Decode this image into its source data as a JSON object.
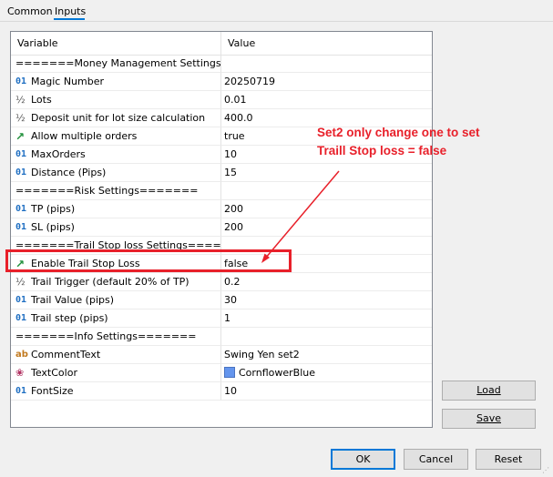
{
  "tabs": {
    "common": "Common",
    "inputs": "Inputs"
  },
  "grid": {
    "col_variable": "Variable",
    "col_value": "Value",
    "rows": [
      {
        "icon": "",
        "variable": "=======Money Management Settings==...",
        "value": ""
      },
      {
        "icon": "01",
        "variable": "Magic Number",
        "value": "20250719"
      },
      {
        "icon": "½",
        "variable": "Lots",
        "value": "0.01"
      },
      {
        "icon": "½",
        "variable": "Deposit unit for lot size calculation",
        "value": "400.0"
      },
      {
        "icon": "↗",
        "variable": "Allow multiple orders",
        "value": "true"
      },
      {
        "icon": "01",
        "variable": "MaxOrders",
        "value": "10"
      },
      {
        "icon": "01",
        "variable": "Distance (Pips)",
        "value": "15"
      },
      {
        "icon": "",
        "variable": "=======Risk Settings=======",
        "value": ""
      },
      {
        "icon": "01",
        "variable": "TP (pips)",
        "value": "200"
      },
      {
        "icon": "01",
        "variable": "SL (pips)",
        "value": "200"
      },
      {
        "icon": "",
        "variable": "=======Trail Stop loss Settings=======",
        "value": ""
      },
      {
        "icon": "↗",
        "variable": "Enable Trail Stop Loss",
        "value": "false"
      },
      {
        "icon": "½",
        "variable": "Trail Trigger (default 20% of TP)",
        "value": "0.2"
      },
      {
        "icon": "01",
        "variable": "Trail Value (pips)",
        "value": "30"
      },
      {
        "icon": "01",
        "variable": "Trail step (pips)",
        "value": "1"
      },
      {
        "icon": "",
        "variable": "=======Info Settings=======",
        "value": ""
      },
      {
        "icon": "ab",
        "variable": "CommentText",
        "value": "Swing Yen set2"
      },
      {
        "icon": "❀",
        "variable": "TextColor",
        "value": "CornflowerBlue"
      },
      {
        "icon": "01",
        "variable": "FontSize",
        "value": "10"
      }
    ]
  },
  "annotation": {
    "line1": "Set2 only change one to set",
    "line2": "Traill Stop loss = false",
    "color": "#e8202a"
  },
  "buttons": {
    "load": "Load",
    "save": "Save",
    "ok": "OK",
    "cancel": "Cancel",
    "reset": "Reset"
  },
  "colors": {
    "swatch": "#6495ed",
    "accent": "#0078d7"
  }
}
